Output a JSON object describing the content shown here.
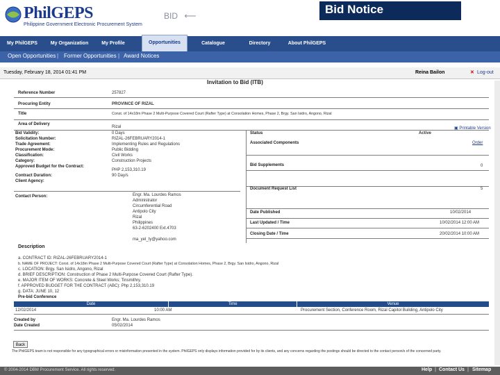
{
  "header": {
    "logo_title": "PhilGEPS",
    "logo_subtitle": "Philippine Government Electronic Procurement System",
    "bid_label": "BID",
    "notice_title": "Bid Notice"
  },
  "nav": {
    "tabs": [
      "My PhilGEPS",
      "My Organization",
      "My Profile",
      "Opportunities",
      "Catalogue",
      "Directory",
      "About PhilGEPS"
    ],
    "subnav": [
      "Open Opportunities",
      "Former Opportunities",
      "Award Notices"
    ]
  },
  "datebar": {
    "date_text": "Tuesday, February 18, 2014 01:41 PM",
    "user": "Reina Bailon",
    "logout": "Log-out"
  },
  "content": {
    "page_heading": "Invitation to Bid (ITB)",
    "reference_label": "Reference Number",
    "reference_value": "257827",
    "procuring_label": "Procuring Entity",
    "procuring_value": "PROVINCE OF RIZAL",
    "title_label": "Title",
    "title_value": "Const. of 14x18m Phase 2 Multi-Purpose Covered Court (Rafter Type) at Consolation Homes, Phase 2, Brgy. San Isidro, Angono, Rizal",
    "area_label": "Area of Delivery",
    "area_value": "Rizal",
    "printable_link": "Printable Version",
    "details": [
      {
        "label": "Bid Validity:",
        "value": "0 Days"
      },
      {
        "label": "Solicitation Number:",
        "value": "RIZAL-26FEBRUARY2014-1"
      },
      {
        "label": "Trade Agreement:",
        "value": "Implementing Rules and Regulations"
      },
      {
        "label": "Procurement Mode:",
        "value": "Public Bidding"
      },
      {
        "label": "Classification:",
        "value": "Civil Works"
      },
      {
        "label": "Category:",
        "value": "Construction Projects"
      },
      {
        "label": "Approved Budget for the Contract:",
        "value": "PHP 2,153,310.19"
      },
      {
        "label": "Contract Duration:",
        "value": "90 Day/s"
      },
      {
        "label": "Client Agency:",
        "value": ""
      }
    ],
    "contact_label": "Contact Person:",
    "contact_lines": [
      "Engr. Ma. Lourdes Ramos",
      "Administrator",
      "Circumferential Road",
      "Antipolo City",
      "Rizal",
      "Philippines",
      "63-2-6202400 Ext.4703",
      "",
      "ma_yel_ty@yahoo.com"
    ],
    "status_label": "Status",
    "status_value": "Active",
    "assoc_label": "Associated Components",
    "assoc_value": "Order",
    "supplements_label": "Bid Supplements",
    "supplements_value": "0",
    "docs_label": "Document Request List",
    "docs_value": "5",
    "published_label": "Date Published",
    "published_value": "10/02/2014",
    "updated_label": "Last Updated / Time",
    "updated_value": "10/02/2014 12:00 AM",
    "closing_label": "Closing Date / Time",
    "closing_value": "20/02/2014 10:00 AM",
    "description_label": "Description",
    "description_lines": [
      "a. CONTRACT ID: RIZAL-26FEBRUARY2014-1",
      "b. NAME OF PROJECT: Const. of 14x18m Phase 2 Multi-Purpose Covered Court (Rafter Type) at Consolation Homes, Phase 2, Brgy. San Isidro, Angono, Rizal",
      "c. LOCATION: Brgy. San Isidro, Angono, Rizal",
      "d. BRIEF DESCRIPTION: Construction of Phase 2 Multi-Purpose Covered Court (Rafter Type).",
      "e. MAJOR ITEM OF WORKS: Concrete & Steel Works; Tinsmithry.",
      "f. APPROVED BUDGET FOR THE CONTRACT (ABC): Php 2,153,310.19",
      "g. DATA: JUNE 10, 12"
    ],
    "prebid_label": "Pre-bid Conference",
    "prebid_headers": [
      "Date",
      "Time",
      "Venue"
    ],
    "prebid_row": [
      "12/02/2014",
      "10:00 AM",
      "Procurement Section, Conference Room, Rizal Capitol Building, Antipolo City"
    ],
    "created_by_label": "Created by",
    "created_by_value": "Engr. Ma. Lourdes Ramos",
    "date_created_label": "Date Created",
    "date_created_value": "05/02/2014",
    "back_button": "Back",
    "disclaimer": "The PhilGEPS team is not responsible for any typographical errors or misinformation presented in the system. PhilGEPS only displays information provided for by its clients, and any concerns regarding the postings should be directed to the contact person/s of the concerned party."
  },
  "footer": {
    "copyright": "© 2004-2014 DBM Procurement Service. All rights reserved.",
    "links": [
      "Help",
      "Contact Us",
      "Sitemap"
    ]
  },
  "colors": {
    "navbar": "#2a4e8c",
    "notice_box": "#0c2a5a",
    "table_header": "#244b8a",
    "logout_x": "#cc0000"
  }
}
